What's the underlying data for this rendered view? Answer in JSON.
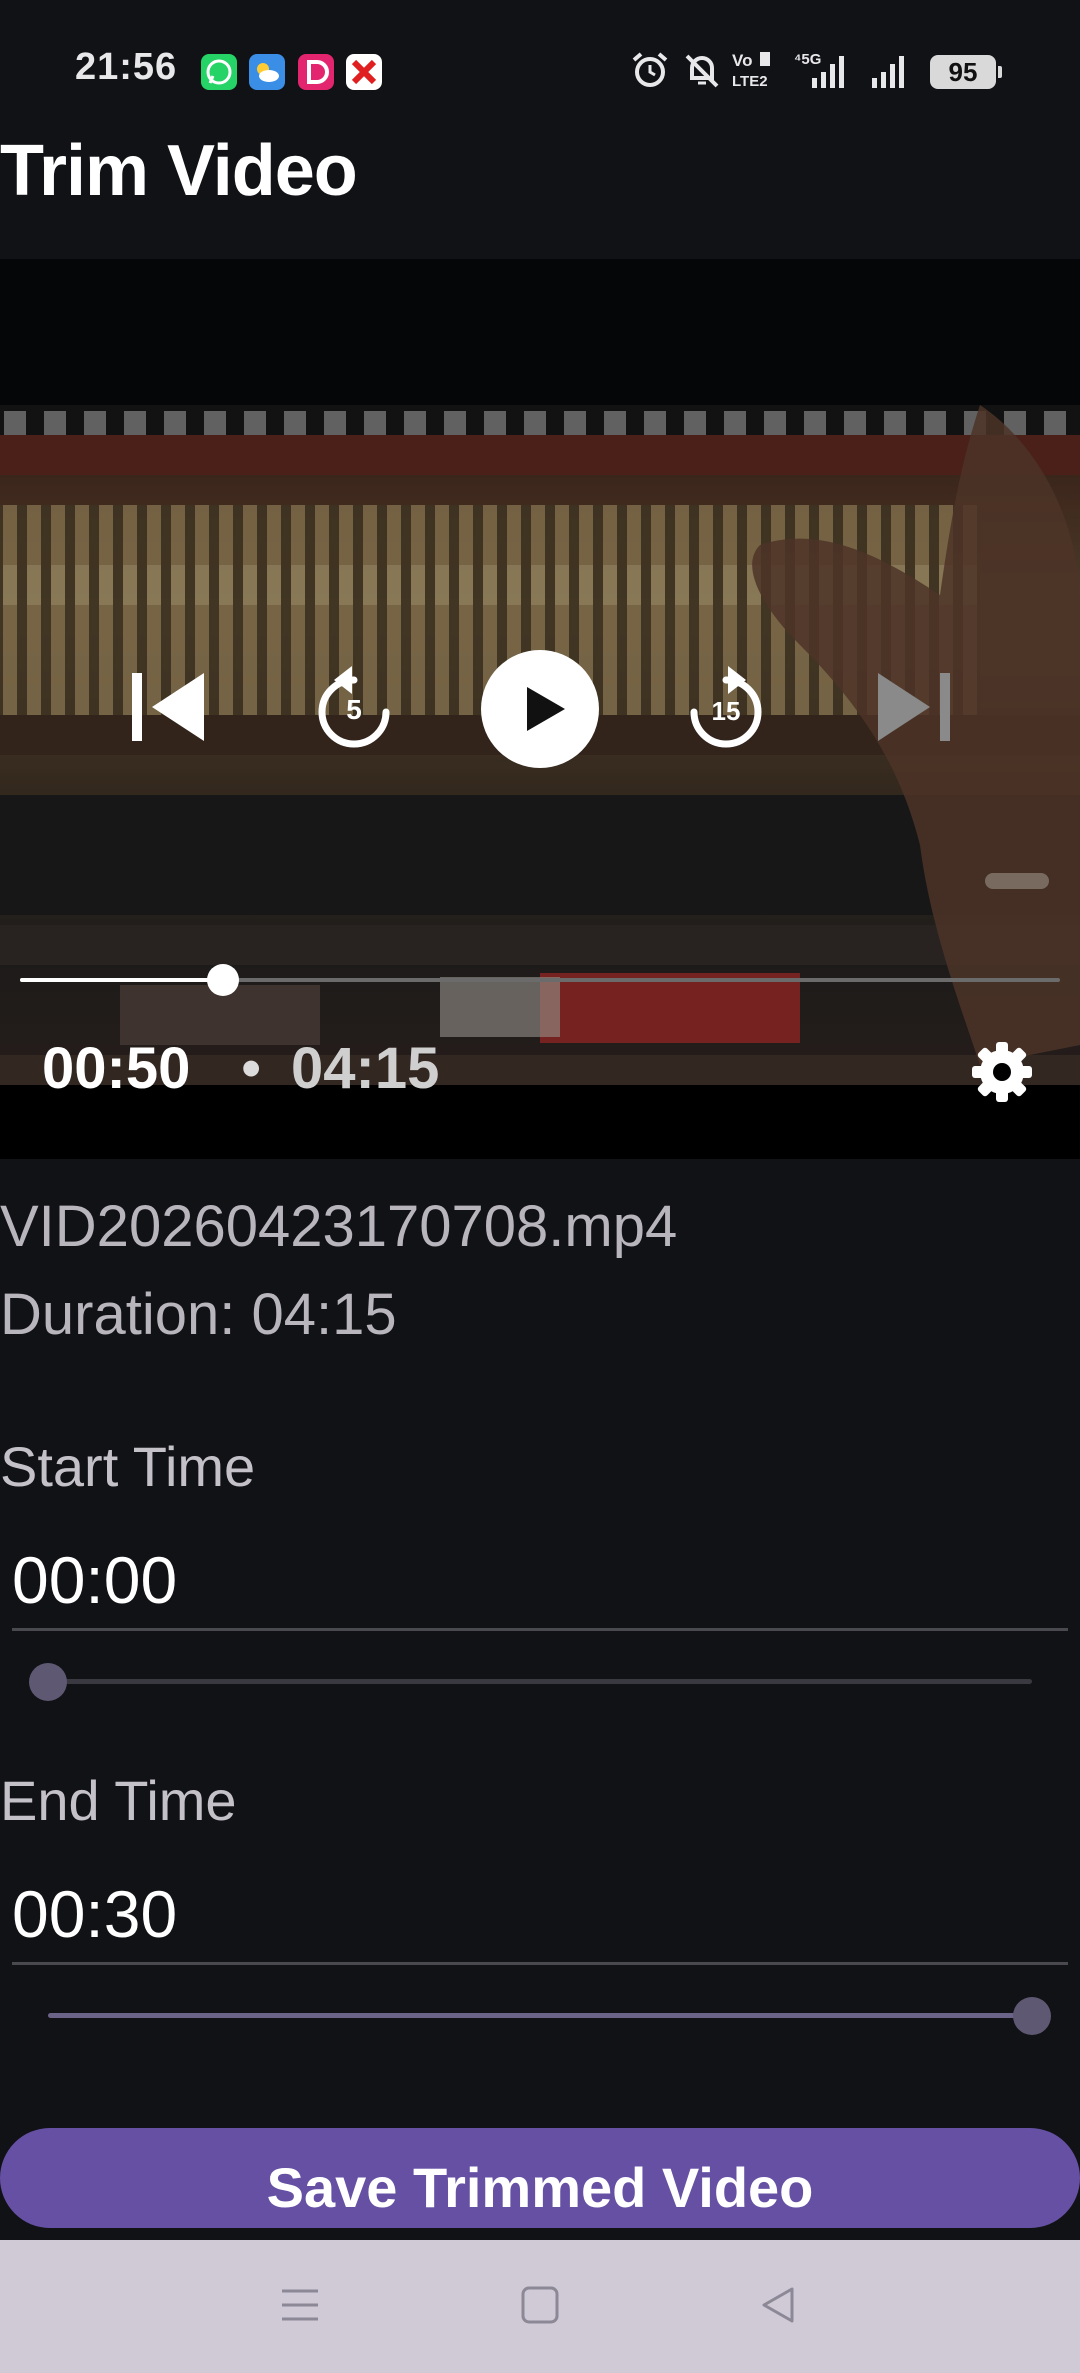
{
  "status_bar": {
    "time": "21:56",
    "battery": "95",
    "notification_icons": [
      "whatsapp-icon",
      "weather-icon",
      "dailyhunt-icon",
      "news-icon"
    ],
    "system_icons": [
      "alarm-icon",
      "mute-bell-icon",
      "volte-icon",
      "signal-5g-icon",
      "signal-icon",
      "battery-icon"
    ]
  },
  "app_bar": {
    "title": "Trim Video"
  },
  "player": {
    "current_time": "00:50",
    "separator": "•",
    "total_time": "04:15",
    "progress": 0.196,
    "rewind_seconds": "5",
    "forward_seconds": "15",
    "controls": [
      "skip-previous-icon",
      "rewind-5-icon",
      "play-icon",
      "forward-15-icon",
      "skip-next-icon",
      "settings-gear-icon"
    ]
  },
  "file": {
    "name": "VID20260423170708.mp4",
    "duration_label": "Duration: 04:15"
  },
  "start": {
    "label": "Start Time",
    "value": "00:00",
    "slider_fraction": 0.0
  },
  "end": {
    "label": "End Time",
    "value": "00:30",
    "slider_fraction": 1.0
  },
  "save_button": {
    "label": "Save Trimmed Video"
  },
  "nav_bar": {
    "buttons": [
      "menu-icon",
      "home-icon",
      "back-icon"
    ]
  },
  "colors": {
    "background": "#111216",
    "accent": "#6650a4",
    "nav_bar": "#cfcad6"
  }
}
